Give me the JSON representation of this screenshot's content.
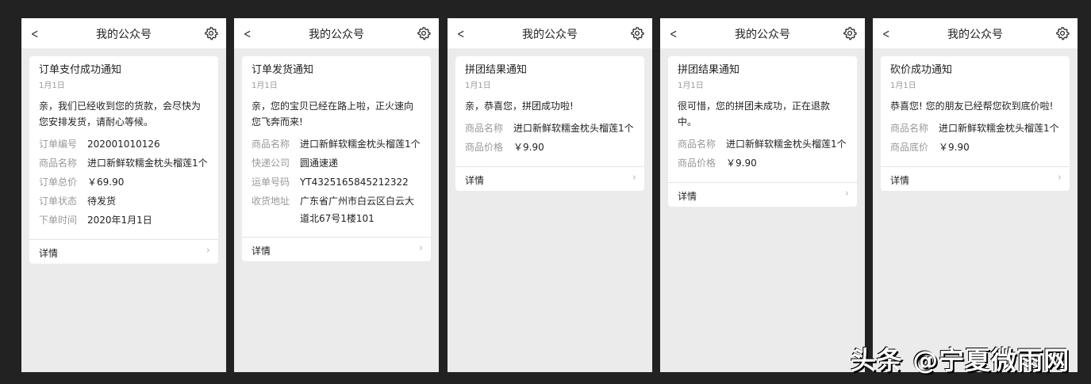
{
  "header_title": "我的公众号",
  "detail_label": "详情",
  "watermark": "头条 @宁夏微雨网",
  "panels": [
    {
      "title": "订单支付成功通知",
      "date": "1月1日",
      "body": "亲，我们已经收到您的货款，会尽快为您安排发货，请耐心等候。",
      "rows": [
        [
          "订单编号",
          "202001010126"
        ],
        [
          "商品名称",
          "进口新鲜软糯金枕头榴莲1个"
        ],
        [
          "订单总价",
          "￥69.90"
        ],
        [
          "订单状态",
          "待发货"
        ],
        [
          "下单时间",
          "2020年1月1日"
        ]
      ]
    },
    {
      "title": "订单发货通知",
      "date": "1月1日",
      "body": "亲，您的宝贝已经在路上啦，正火速向您飞奔而来!",
      "rows": [
        [
          "商品名称",
          "进口新鲜软糯金枕头榴莲1个"
        ],
        [
          "快递公司",
          "圆通速递"
        ],
        [
          "运单号码",
          "YT4325165845212322"
        ],
        [
          "收货地址",
          "广东省广州市白云区白云大道北67号1楼101"
        ]
      ]
    },
    {
      "title": "拼团结果通知",
      "date": "1月1日",
      "body": "亲，恭喜您，拼团成功啦!",
      "rows": [
        [
          "商品名称",
          "进口新鲜软糯金枕头榴莲1个"
        ],
        [
          "商品价格",
          "￥9.90"
        ]
      ]
    },
    {
      "title": "拼团结果通知",
      "date": "1月1日",
      "body": "很可惜，您的拼团未成功，正在退款中。",
      "rows": [
        [
          "商品名称",
          "进口新鲜软糯金枕头榴莲1个"
        ],
        [
          "商品价格",
          "￥9.90"
        ]
      ]
    },
    {
      "title": "砍价成功通知",
      "date": "1月1日",
      "body": "恭喜您! 您的朋友已经帮您砍到底价啦!",
      "rows": [
        [
          "商品名称",
          "进口新鲜软糯金枕头榴莲1个"
        ],
        [
          "商品底价",
          "￥9.90"
        ]
      ]
    }
  ]
}
